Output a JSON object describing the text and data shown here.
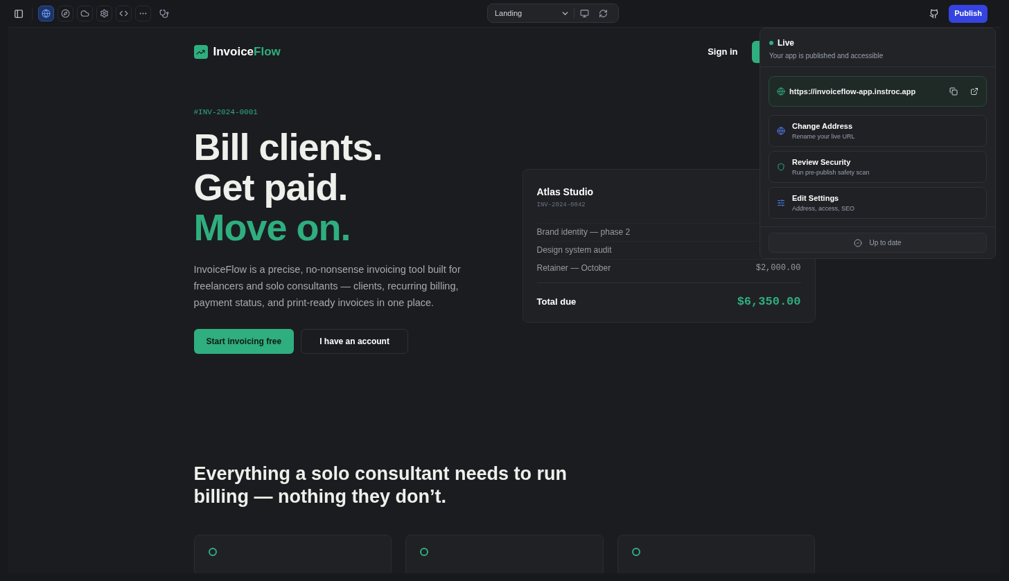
{
  "toolbar": {
    "tools": [
      {
        "kind": "globe",
        "selected": true
      },
      {
        "kind": "compass",
        "selected": false
      },
      {
        "kind": "cloud",
        "selected": false
      },
      {
        "kind": "gear",
        "selected": false
      },
      {
        "kind": "code",
        "selected": false
      },
      {
        "kind": "more",
        "selected": false
      }
    ]
  },
  "page_select": {
    "value": "Landing"
  },
  "publish_button": "Publish",
  "site": {
    "logo": {
      "word": "Invoice",
      "accent": "Flow"
    },
    "nav": {
      "sign_in": "Sign in"
    },
    "hero": {
      "tag": "#INV-2024-0001",
      "lines": [
        {
          "text": "Bill clients.",
          "accent": false
        },
        {
          "text": "Get paid.",
          "accent": false
        },
        {
          "text": "Move on.",
          "accent": true
        }
      ],
      "body": "InvoiceFlow is a precise, no-nonsense invoicing tool built for freelancers and solo consultants — clients, recurring billing, payment status, and print-ready invoices in one place.",
      "primary": "Start invoicing free",
      "secondary": "I have an account"
    },
    "invoice": {
      "client": "Atlas Studio",
      "number": "INV-2024-0042",
      "items": [
        {
          "label": "Brand identity — phase 2"
        },
        {
          "label": "Design system audit"
        },
        {
          "label": "Retainer — October",
          "amount": "$2,000.00"
        }
      ],
      "total_label": "Total due",
      "total": "$6,350.00"
    },
    "features": {
      "heading": "Everything a solo consultant needs to run billing — nothing they don’t.",
      "cards": [
        {
          "kind": "card"
        },
        {
          "kind": "card"
        },
        {
          "kind": "card"
        }
      ]
    }
  },
  "publish_panel": {
    "status": "Live",
    "live": true,
    "subtitle": "Your app is published and accessible",
    "url": "https://invoiceflow-app.instroc.app",
    "actions": [
      {
        "kind": "address",
        "title": "Change Address",
        "subtitle": "Rename your live URL"
      },
      {
        "kind": "security",
        "title": "Review Security",
        "subtitle": "Run pre-publish safety scan"
      },
      {
        "kind": "settings",
        "title": "Edit Settings",
        "subtitle": "Address, access, SEO"
      }
    ],
    "footer": "Up to date"
  }
}
